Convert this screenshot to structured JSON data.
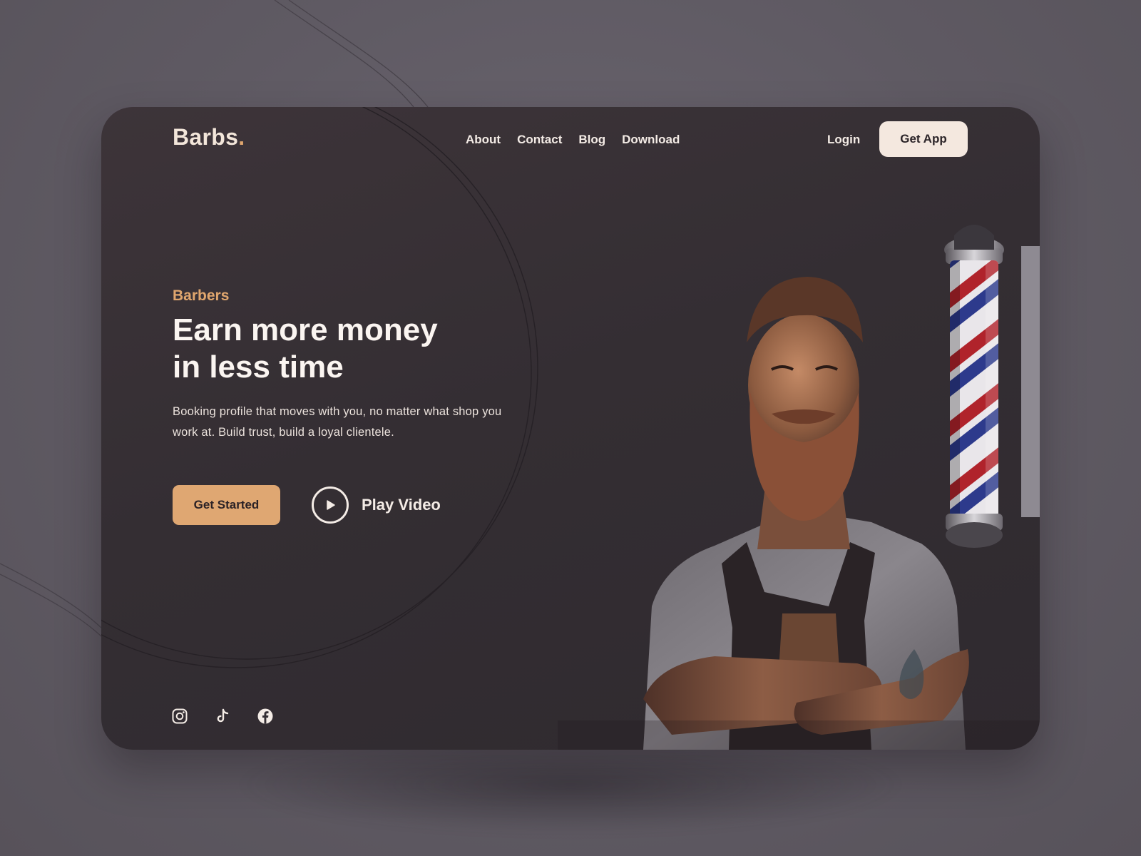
{
  "header": {
    "logo_text": "Barbs",
    "logo_dot": ".",
    "nav": [
      {
        "label": "About"
      },
      {
        "label": "Contact"
      },
      {
        "label": "Blog"
      },
      {
        "label": "Download"
      }
    ],
    "login_label": "Login",
    "cta_label": "Get App"
  },
  "hero": {
    "eyebrow": "Barbers",
    "headline_line1": "Earn more money",
    "headline_line2": "in less time",
    "subtitle": "Booking profile that moves with you, no matter what shop you work at. Build trust, build a loyal clientele.",
    "primary_cta": "Get Started",
    "video_label": "Play Video"
  },
  "socials": [
    {
      "icon": "instagram-icon"
    },
    {
      "icon": "tiktok-icon"
    },
    {
      "icon": "facebook-icon"
    }
  ],
  "colors": {
    "accent": "#dfa772",
    "card_bg": "#342e33",
    "page_bg": "#625d66",
    "text_light": "#f4ece6",
    "button_light": "#f4e8df"
  }
}
